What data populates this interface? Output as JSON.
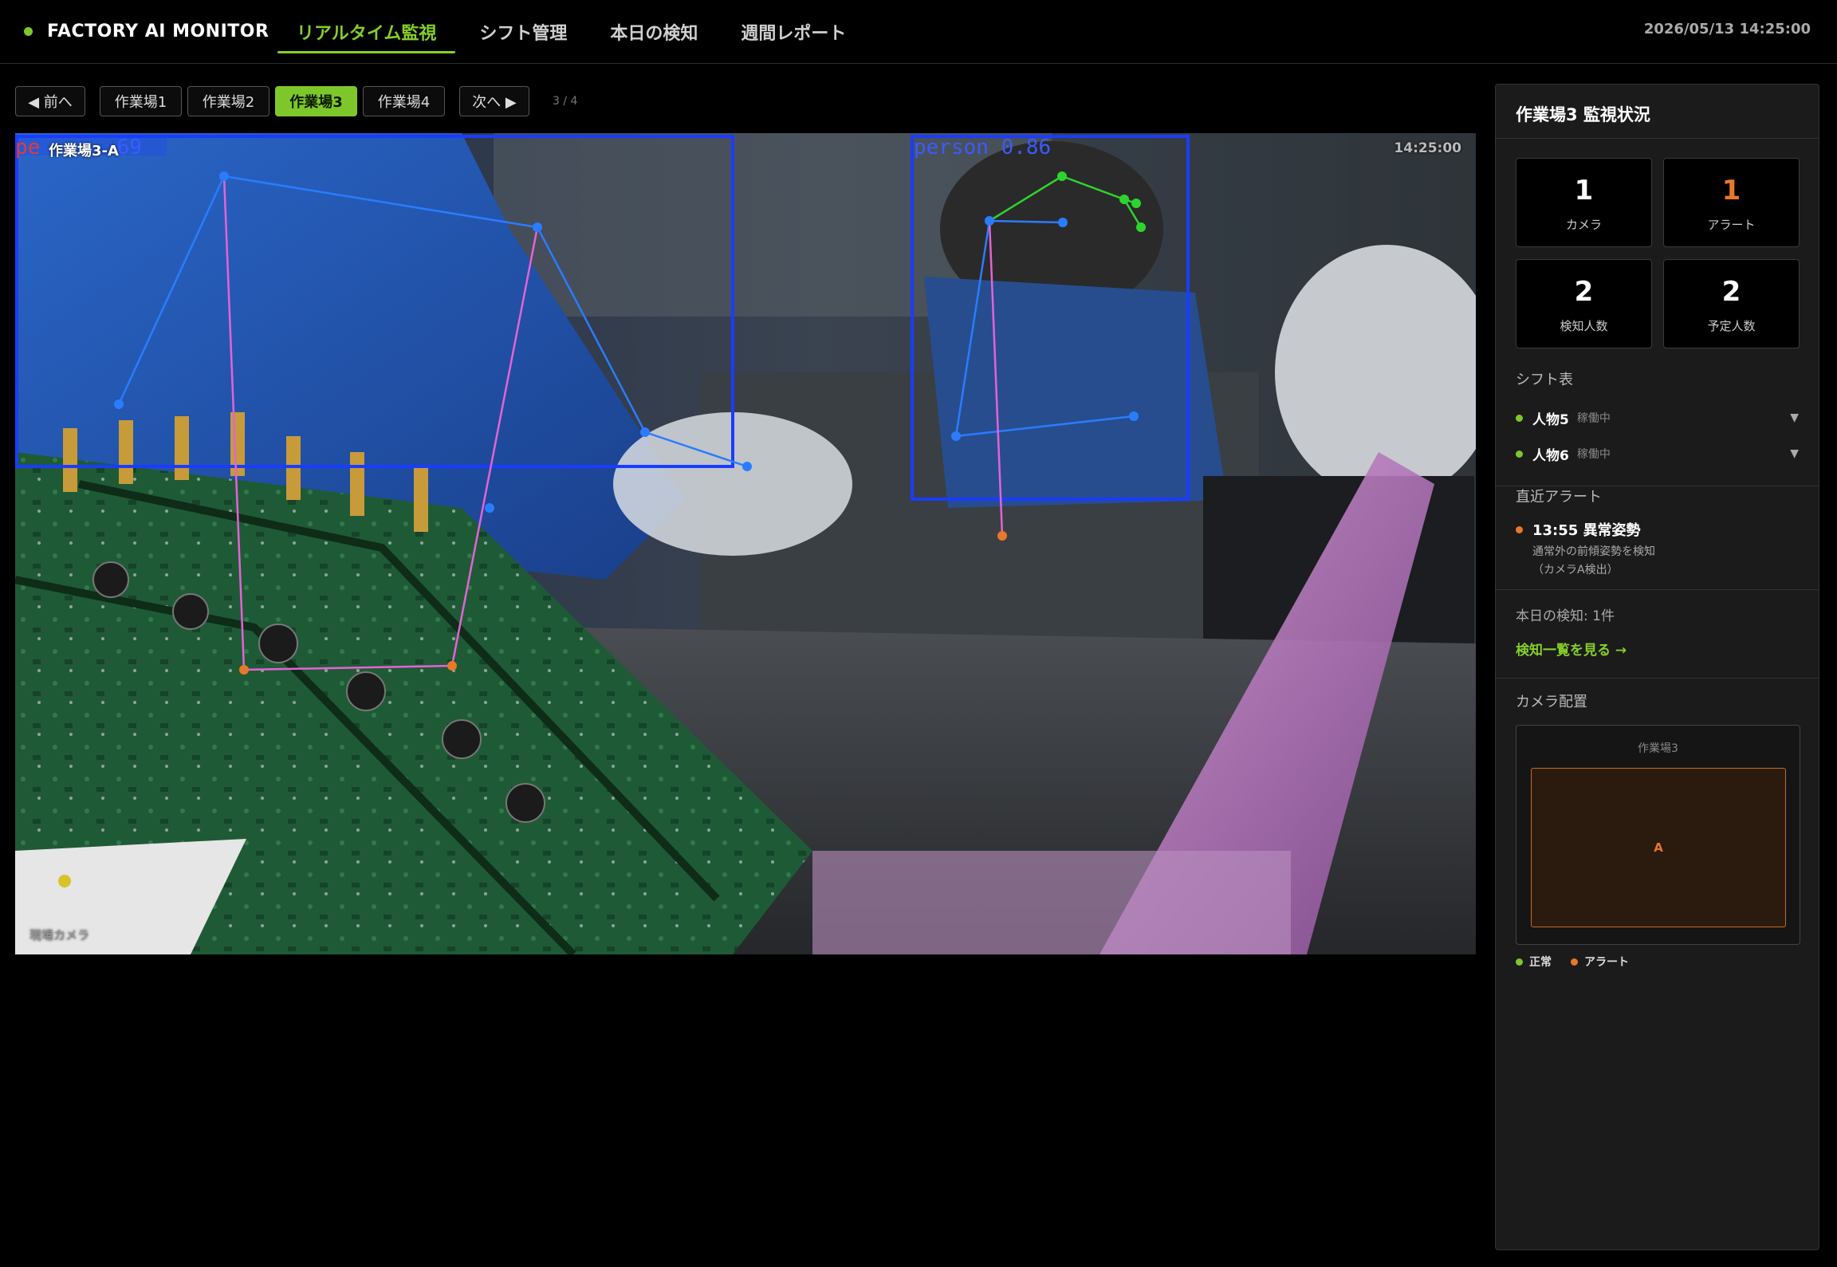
{
  "brand": {
    "name": "FACTORY AI MONITOR"
  },
  "nav": {
    "tabs": [
      "リアルタイム監視",
      "シフト管理",
      "本日の検知",
      "週間レポート"
    ],
    "active": 0
  },
  "clock": "2026/05/13 14:25:00",
  "switcher": {
    "prev": "◀ 前へ",
    "cams": [
      "作業場1",
      "作業場2",
      "作業場3",
      "作業場4"
    ],
    "active": 2,
    "next": "次へ ▶",
    "count": "3 / 4"
  },
  "video": {
    "cam_label": "作業場3-A",
    "time": "14:25:00",
    "type": "現場カメラ",
    "detections": [
      {
        "label": "person 0.69",
        "partial_label": ".69",
        "color": "#1a3cff"
      },
      {
        "label": "person 0.86",
        "color": "#1a3cff"
      }
    ]
  },
  "panel": {
    "title": "作業場3 監視状況",
    "stats": [
      {
        "value": "1",
        "label": "カメラ"
      },
      {
        "value": "1",
        "label": "アラート",
        "alert": true
      },
      {
        "value": "2",
        "label": "検知人数"
      },
      {
        "value": "2",
        "label": "予定人数"
      }
    ],
    "shift_title": "シフト表",
    "shifts": [
      {
        "name": "人物5",
        "status": "稼働中"
      },
      {
        "name": "人物6",
        "status": "稼働中"
      }
    ],
    "alert_title": "直近アラート",
    "alert": {
      "head": "13:55 異常姿勢",
      "desc1": "通常外の前傾姿勢を検知",
      "desc2": "（カメラA検出）"
    },
    "today": "本日の検知: 1件",
    "link": "検知一覧を見る →",
    "map_title": "カメラ配置",
    "map_zone": "作業場3",
    "map_cam": "A",
    "legend": {
      "normal": "正常",
      "alert": "アラート"
    }
  },
  "colors": {
    "accent": "#7ec72a",
    "alert": "#e8782a",
    "box": "#1a3cff"
  },
  "icons": {
    "prev": "triangle-left-icon",
    "next": "triangle-right-icon",
    "chevron": "chevron-down-icon"
  }
}
